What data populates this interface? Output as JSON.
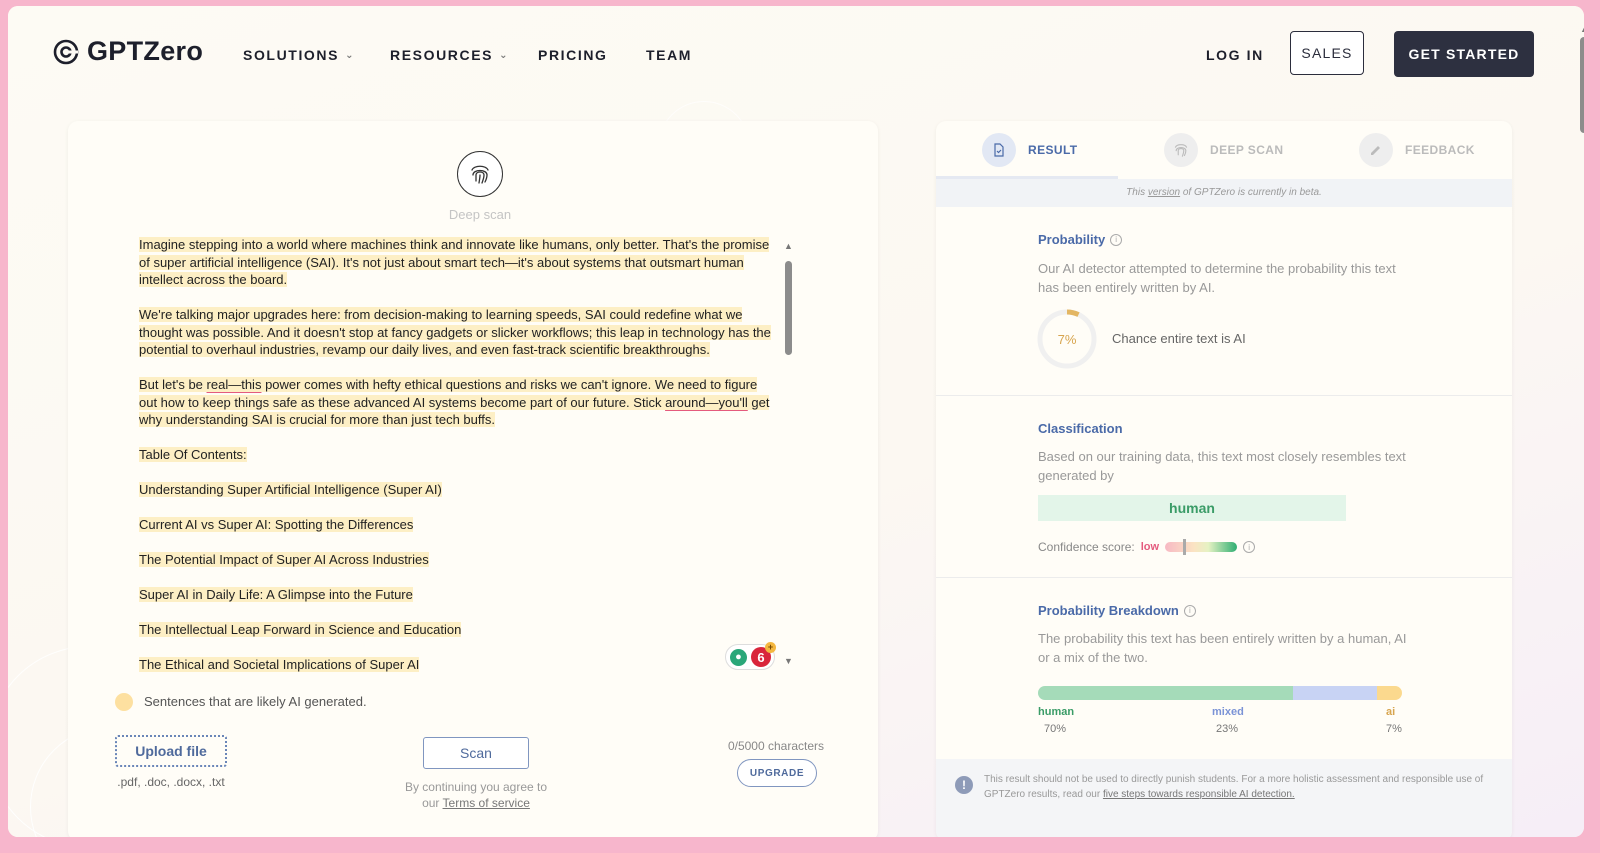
{
  "nav": {
    "logo_text": "GPTZero",
    "solutions": "SOLUTIONS",
    "resources": "RESOURCES",
    "pricing": "PRICING",
    "team": "TEAM",
    "login": "LOG IN",
    "sales": "SALES",
    "get_started": "GET STARTED"
  },
  "editor": {
    "deep_scan_label": "Deep scan",
    "paragraphs": [
      "Imagine stepping into a world where machines think and innovate like humans, only better. That's the promise of super artificial intelligence (SAI). It's not just about smart tech—it's about systems that outsmart human intellect across the board.",
      "We're talking major upgrades here: from decision-making to learning speeds, SAI could redefine what we thought was possible. And it doesn't stop at fancy gadgets or slicker workflows; this leap in technology has the potential to overhaul industries, revamp our daily lives, and even fast-track scientific breakthroughs.",
      "",
      "Table Of Contents:",
      "Understanding Super Artificial Intelligence (Super AI)",
      "Current AI vs Super AI: Spotting the Differences",
      "The Potential Impact of Super AI Across Industries",
      "Super AI in Daily Life: A Glimpse into the Future",
      "The Intellectual Leap Forward in Science and Education",
      "The Ethical and Societal Implications of Super AI"
    ],
    "p3": {
      "t1": "But let's be ",
      "u1": "real—this",
      "t2": " power comes with hefty ethical questions and risks we can't ignore. We need to figure out how to keep things safe as these advanced AI systems become part of our future. Stick ",
      "u2": "around—you'll",
      "t3": " get why understanding SAI is crucial for more than just tech buffs."
    },
    "suggestion_count": "6",
    "legend": "Sentences that are likely AI generated.",
    "upload_label": "Upload file",
    "upload_types": ".pdf, .doc, .docx, .txt",
    "scan_label": "Scan",
    "terms_prefix": "By continuing you agree to our ",
    "terms_link": "Terms of service",
    "char_count": "0/5000 characters",
    "upgrade_label": "UPGRADE"
  },
  "result": {
    "tabs": [
      {
        "label": "RESULT",
        "active": true
      },
      {
        "label": "DEEP SCAN",
        "active": false
      },
      {
        "label": "FEEDBACK",
        "active": false
      }
    ],
    "beta": {
      "prefix": "This ",
      "link": "version",
      "suffix": " of GPTZero is currently in beta."
    },
    "probability": {
      "title": "Probability",
      "desc": "Our AI detector attempted to determine the probability this text has been entirely written by AI.",
      "percent_label": "7%",
      "percent_value": 7,
      "caption": "Chance entire text is AI"
    },
    "classification": {
      "title": "Classification",
      "desc": "Based on our training data, this text most closely resembles text generated by",
      "label": "human",
      "confidence_label": "Confidence score:",
      "confidence_value": "low"
    },
    "breakdown": {
      "title": "Probability Breakdown",
      "desc": "The probability this text has been entirely written by a human, AI or a mix of the two.",
      "items": [
        {
          "name": "human",
          "pct_label": "70%",
          "pct": 70,
          "color": "#a5dbb9",
          "text_color": "#3a9c67"
        },
        {
          "name": "mixed",
          "pct_label": "23%",
          "pct": 23,
          "color": "#c8d3f4",
          "text_color": "#7b93d6"
        },
        {
          "name": "ai",
          "pct_label": "7%",
          "pct": 7,
          "color": "#fbd98e",
          "text_color": "#d7a54f"
        }
      ]
    },
    "footer": {
      "prefix": "This result should not be used to directly punish students. For a more holistic assessment and responsible use of GPTZero results, read our ",
      "link": "five steps towards responsible AI detection."
    }
  },
  "colors": {
    "accent": "#4a6aa8",
    "dark": "#2d3040",
    "highlight": "#fdefc5",
    "gauge": "#e3b663"
  }
}
